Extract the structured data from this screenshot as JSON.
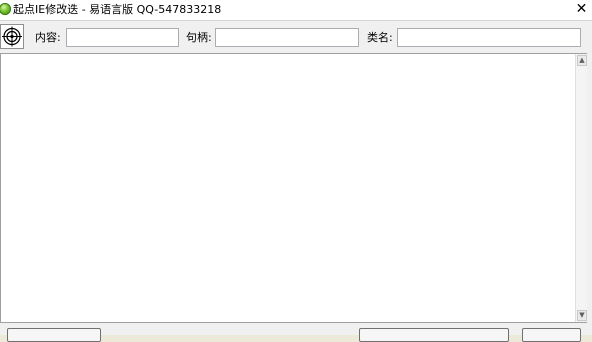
{
  "window": {
    "title": "起点IE修改迭 - 易语言版 QQ-547833218",
    "close_glyph": "✕"
  },
  "toolbar": {
    "target_icon": "crosshair-target-icon",
    "content_label": "内容:",
    "content_value": "",
    "handle_label": "句柄:",
    "handle_value": "",
    "class_label": "类名:",
    "class_value": ""
  },
  "main": {
    "text": ""
  },
  "scrollbar": {
    "up_glyph": "▲",
    "down_glyph": "▼"
  }
}
